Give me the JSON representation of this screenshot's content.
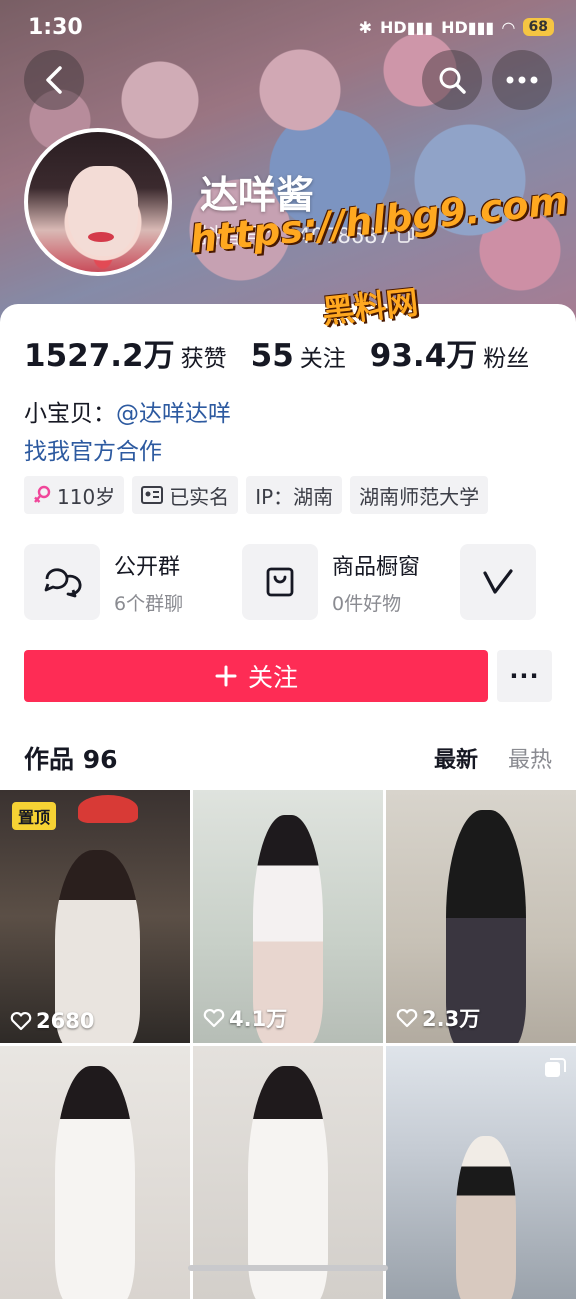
{
  "status_bar": {
    "time": "1:30",
    "battery": "68"
  },
  "profile": {
    "nickname": "达咩酱",
    "douyin_id": "抖音号：34078687"
  },
  "watermark": {
    "url": "https://hlbg9.com",
    "name": "黑料网"
  },
  "stats": [
    {
      "value": "1527.2万",
      "label": "获赞"
    },
    {
      "value": "55",
      "label": "关注"
    },
    {
      "value": "93.4万",
      "label": "粉丝"
    }
  ],
  "bio": {
    "prefix": "小宝贝：",
    "mention": "@达咩达咩",
    "cooperation": "找我官方合作"
  },
  "tags": [
    {
      "icon": "female-icon",
      "text": "110岁"
    },
    {
      "icon": "id-card-icon",
      "text": "已实名"
    },
    {
      "icon": "",
      "text": "IP：湖南"
    },
    {
      "icon": "",
      "text": "湖南师范大学"
    }
  ],
  "features": [
    {
      "icon": "chat-bubbles-icon",
      "title": "公开群",
      "subtitle": "6个群聊"
    },
    {
      "icon": "shopping-bag-icon",
      "title": "商品橱窗",
      "subtitle": "0件好物"
    },
    {
      "icon": "v-icon",
      "title": "",
      "subtitle": ""
    }
  ],
  "actions": {
    "follow": "关注",
    "more": "···"
  },
  "works": {
    "title": "作品 96",
    "sort_latest": "最新",
    "sort_hottest": "最热",
    "pinned_label": "置顶",
    "items": [
      {
        "likes": "2680",
        "pinned": true
      },
      {
        "likes": "4.1万"
      },
      {
        "likes": "2.3万"
      },
      {
        "likes": ""
      },
      {
        "likes": ""
      },
      {
        "likes": "",
        "multi": true
      }
    ]
  }
}
